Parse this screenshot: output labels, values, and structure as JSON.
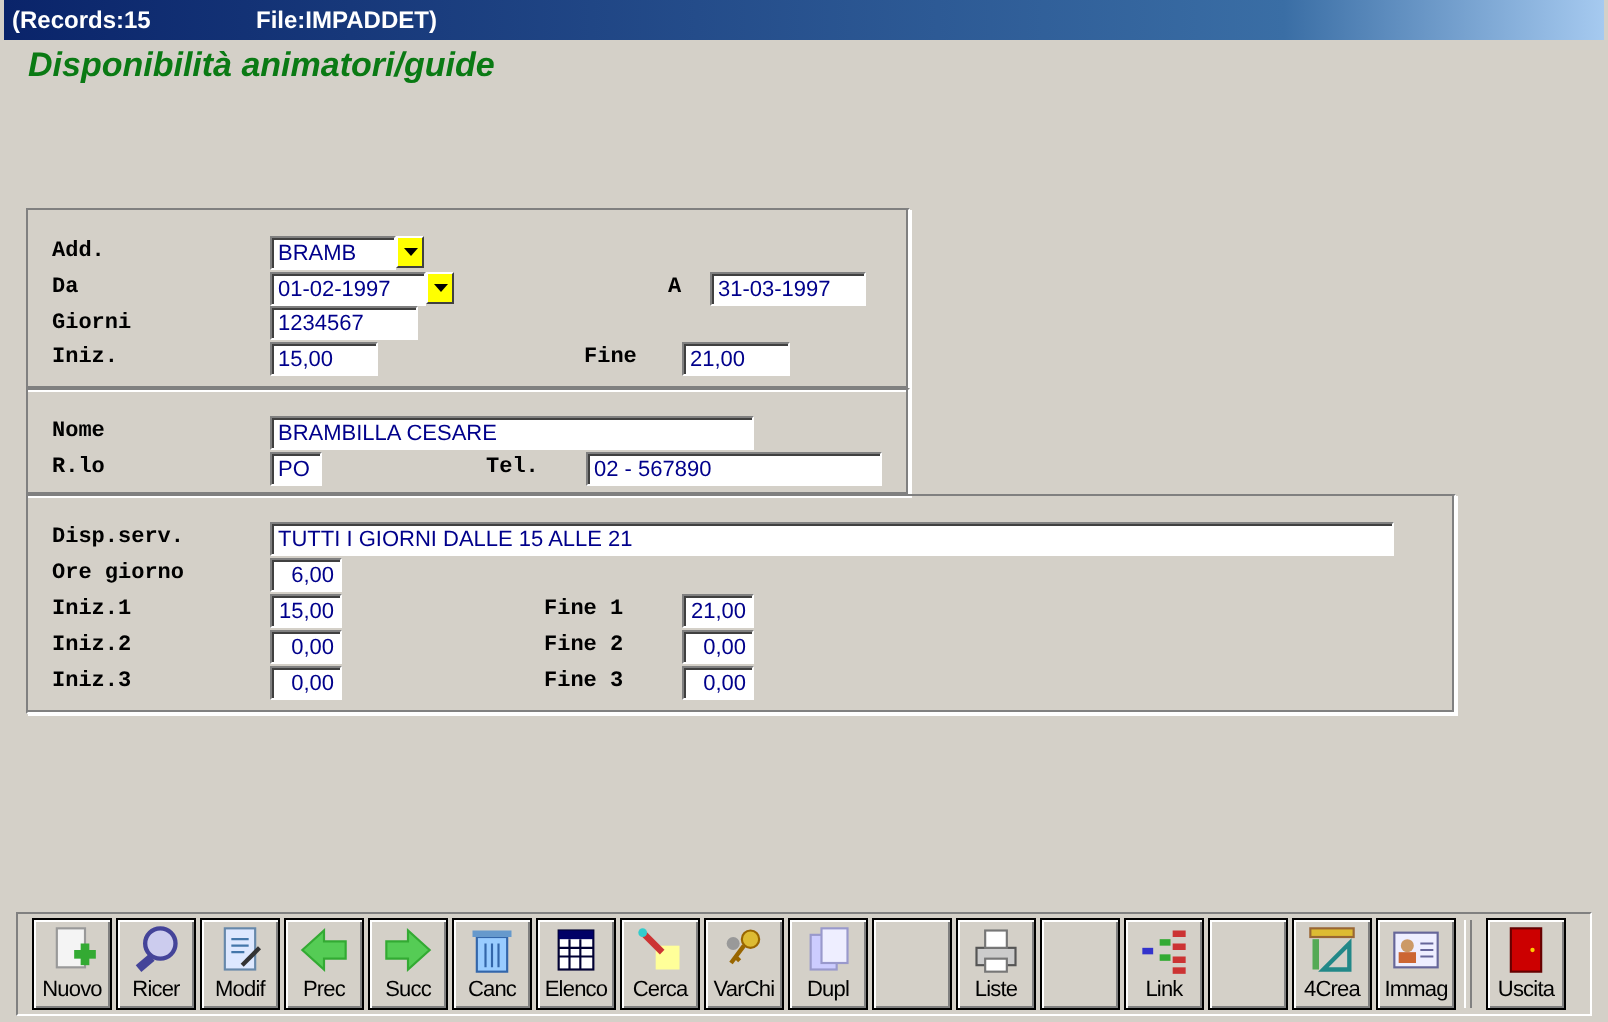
{
  "title_bar": {
    "records": "(Records:15",
    "file": "File:IMPADDET)"
  },
  "heading": "Disponibilità animatori/guide",
  "sections": [
    {
      "rows": [
        [
          {
            "label": "Add.",
            "value": "BRAMB",
            "dropdown": true
          }
        ],
        [
          {
            "label": "Da",
            "value": "01-02-1997",
            "dropdown": true
          },
          {
            "label": "A",
            "value": "31-03-1997"
          }
        ],
        [
          {
            "label": "Giorni",
            "value": "1234567"
          }
        ],
        [
          {
            "label": "Iniz.",
            "value": "15,00"
          },
          {
            "label": "Fine",
            "value": "21,00"
          }
        ]
      ]
    },
    {
      "rows": [
        [
          {
            "label": "Nome",
            "value": "BRAMBILLA CESARE"
          }
        ],
        [
          {
            "label": "R.lo",
            "value": "PO"
          },
          {
            "label": "Tel.",
            "value": "02 - 567890"
          }
        ]
      ]
    },
    {
      "rows": [
        [
          {
            "label": "Disp.serv.",
            "value": "TUTTI I GIORNI DALLE 15 ALLE 21"
          }
        ],
        [
          {
            "label": "Ore giorno",
            "value": "6,00"
          }
        ],
        [
          {
            "label": "Iniz.1",
            "value": "15,00"
          },
          {
            "label": "Fine 1",
            "value": "21,00"
          }
        ],
        [
          {
            "label": "Iniz.2",
            "value": "0,00"
          },
          {
            "label": "Fine 2",
            "value": "0,00"
          }
        ],
        [
          {
            "label": "Iniz.3",
            "value": "0,00"
          },
          {
            "label": "Fine 3",
            "value": "0,00"
          }
        ]
      ]
    }
  ],
  "toolbar": [
    {
      "kind": "button",
      "label": "Nuovo"
    },
    {
      "kind": "button",
      "label": "Ricer"
    },
    {
      "kind": "button",
      "label": "Modif"
    },
    {
      "kind": "button",
      "label": "Prec"
    },
    {
      "kind": "button",
      "label": "Succ"
    },
    {
      "kind": "button",
      "label": "Canc"
    },
    {
      "kind": "button",
      "label": "Elenco"
    },
    {
      "kind": "button",
      "label": "Cerca"
    },
    {
      "kind": "button",
      "label": "VarChi"
    },
    {
      "kind": "button",
      "label": "Dupl"
    },
    {
      "kind": "empty"
    },
    {
      "kind": "button",
      "label": "Liste"
    },
    {
      "kind": "empty"
    },
    {
      "kind": "button",
      "label": "Link"
    },
    {
      "kind": "empty"
    },
    {
      "kind": "button",
      "label": "4Crea"
    },
    {
      "kind": "button",
      "label": "Immag"
    },
    {
      "kind": "button",
      "label": "Uscita"
    }
  ]
}
